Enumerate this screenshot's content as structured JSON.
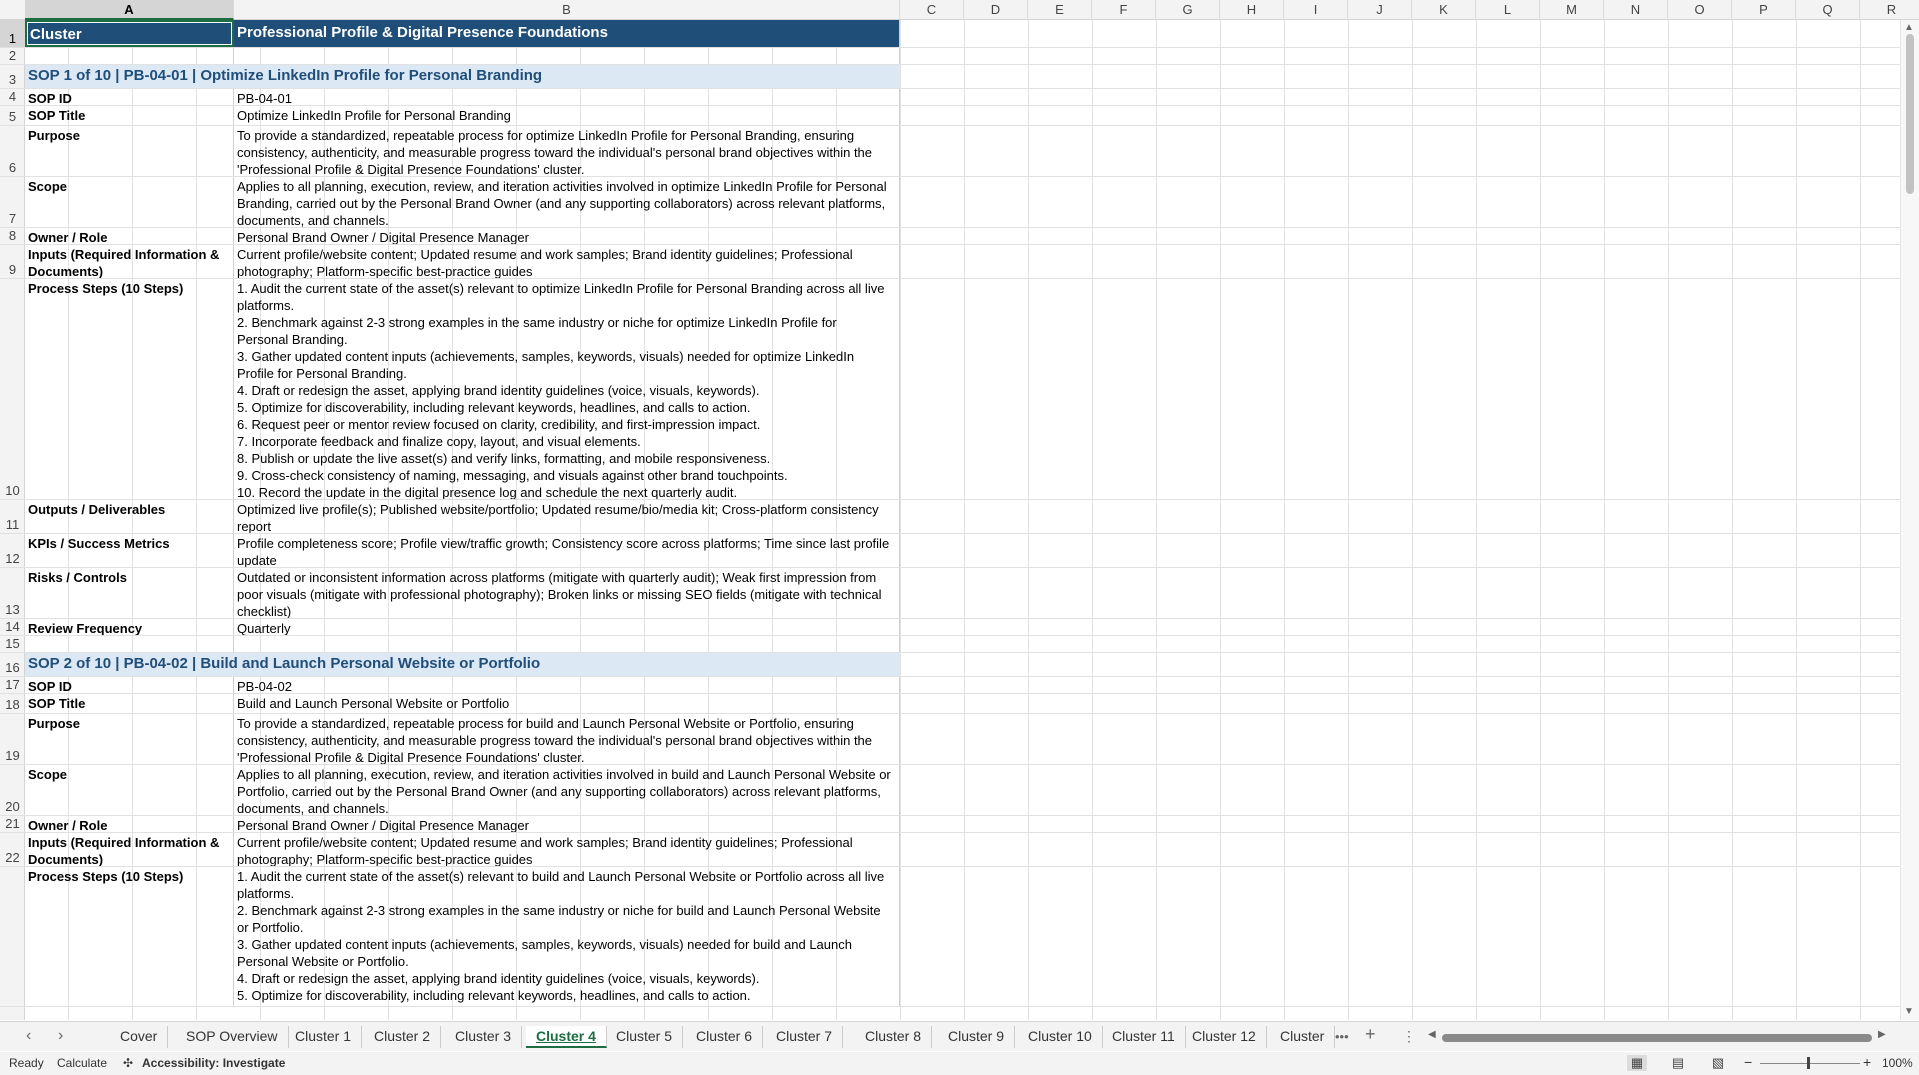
{
  "columns": [
    "A",
    "B",
    "C",
    "D",
    "E",
    "F",
    "G",
    "H",
    "I",
    "J",
    "K",
    "L",
    "M",
    "N",
    "O",
    "P",
    "Q",
    "R"
  ],
  "rows": [
    {
      "num": "1",
      "type": "title",
      "a": "Cluster",
      "b": "Professional Profile & Digital Presence Foundations"
    },
    {
      "num": "2",
      "type": "blank"
    },
    {
      "num": "3",
      "type": "sop",
      "text": "SOP 1 of 10  |  PB-04-01  |  Optimize LinkedIn Profile for Personal Branding"
    },
    {
      "num": "4",
      "type": "field",
      "a": "SOP ID",
      "b": "PB-04-01"
    },
    {
      "num": "5",
      "type": "field",
      "a": "SOP Title",
      "b": "Optimize LinkedIn Profile for Personal Branding"
    },
    {
      "num": "6",
      "type": "field",
      "a": "Purpose",
      "b": "To provide a standardized, repeatable process for optimize LinkedIn Profile for Personal Branding, ensuring\nconsistency, authenticity, and measurable progress toward the individual's personal brand objectives within the\n'Professional Profile & Digital Presence Foundations' cluster."
    },
    {
      "num": "7",
      "type": "field",
      "a": "Scope",
      "b": "Applies to all planning, execution, review, and iteration activities involved in optimize LinkedIn Profile for Personal\nBranding, carried out by the Personal Brand Owner (and any supporting collaborators) across relevant platforms,\ndocuments, and channels."
    },
    {
      "num": "8",
      "type": "field",
      "a": "Owner / Role",
      "b": "Personal Brand Owner / Digital Presence Manager"
    },
    {
      "num": "9",
      "type": "field",
      "a": "Inputs (Required Information &\nDocuments)",
      "b": "Current profile/website content; Updated resume and work samples; Brand identity guidelines; Professional\nphotography; Platform-specific best-practice guides"
    },
    {
      "num": "10",
      "type": "field",
      "a": "Process Steps (10 Steps)",
      "b": "1. Audit the current state of the asset(s) relevant to optimize LinkedIn Profile for Personal Branding across all live\nplatforms.\n2. Benchmark against 2-3 strong examples in the same industry or niche for optimize LinkedIn Profile for\nPersonal Branding.\n3. Gather updated content inputs (achievements, samples, keywords, visuals) needed for optimize LinkedIn\nProfile for Personal Branding.\n4. Draft or redesign the asset, applying brand identity guidelines (voice, visuals, keywords).\n5. Optimize for discoverability, including relevant keywords, headlines, and calls to action.\n6. Request peer or mentor review focused on clarity, credibility, and first-impression impact.\n7. Incorporate feedback and finalize copy, layout, and visual elements.\n8. Publish or update the live asset(s) and verify links, formatting, and mobile responsiveness.\n9. Cross-check consistency of naming, messaging, and visuals against other brand touchpoints.\n10. Record the update in the digital presence log and schedule the next quarterly audit."
    },
    {
      "num": "11",
      "type": "field",
      "a": "Outputs / Deliverables",
      "b": "Optimized live profile(s); Published website/portfolio; Updated resume/bio/media kit; Cross-platform consistency\nreport"
    },
    {
      "num": "12",
      "type": "field",
      "a": "KPIs / Success Metrics",
      "b": "Profile completeness score; Profile view/traffic growth; Consistency score across platforms; Time since last profile\nupdate"
    },
    {
      "num": "13",
      "type": "field",
      "a": "Risks / Controls",
      "b": "Outdated or inconsistent information across platforms (mitigate with quarterly audit); Weak first impression from\npoor visuals (mitigate with professional photography); Broken links or missing SEO fields (mitigate with technical\nchecklist)"
    },
    {
      "num": "14",
      "type": "field",
      "a": "Review Frequency",
      "b": "Quarterly"
    },
    {
      "num": "15",
      "type": "blank"
    },
    {
      "num": "16",
      "type": "sop",
      "text": "SOP 2 of 10  |  PB-04-02  |  Build and Launch Personal Website or Portfolio"
    },
    {
      "num": "17",
      "type": "field",
      "a": "SOP ID",
      "b": "PB-04-02"
    },
    {
      "num": "18",
      "type": "field",
      "a": "SOP Title",
      "b": "Build and Launch Personal Website or Portfolio"
    },
    {
      "num": "19",
      "type": "field",
      "a": "Purpose",
      "b": "To provide a standardized, repeatable process for build and Launch Personal Website or Portfolio, ensuring\nconsistency, authenticity, and measurable progress toward the individual's personal brand objectives within the\n'Professional Profile & Digital Presence Foundations' cluster."
    },
    {
      "num": "20",
      "type": "field",
      "a": "Scope",
      "b": "Applies to all planning, execution, review, and iteration activities involved in build and Launch Personal Website or\nPortfolio, carried out by the Personal Brand Owner (and any supporting collaborators) across relevant platforms,\ndocuments, and channels."
    },
    {
      "num": "21",
      "type": "field",
      "a": "Owner / Role",
      "b": "Personal Brand Owner / Digital Presence Manager"
    },
    {
      "num": "22",
      "type": "field",
      "a": "Inputs (Required Information &\nDocuments)",
      "b": "Current profile/website content; Updated resume and work samples; Brand identity guidelines; Professional\nphotography; Platform-specific best-practice guides"
    },
    {
      "num": "",
      "type": "field",
      "a": "Process Steps (10 Steps)",
      "b": "1. Audit the current state of the asset(s) relevant to build and Launch Personal Website or Portfolio across all live\nplatforms.\n2. Benchmark against 2-3 strong examples in the same industry or niche for build and Launch Personal Website\nor Portfolio.\n3. Gather updated content inputs (achievements, samples, keywords, visuals) needed for build and Launch\nPersonal Website or Portfolio.\n4. Draft or redesign the asset, applying brand identity guidelines (voice, visuals, keywords).\n5. Optimize for discoverability, including relevant keywords, headlines, and calls to action."
    }
  ],
  "tabs": [
    "Cover",
    "SOP Overview",
    "Cluster 1",
    "Cluster 2",
    "Cluster 3",
    "Cluster 4",
    "Cluster 5",
    "Cluster 6",
    "Cluster 7",
    "Cluster 8",
    "Cluster 9",
    "Cluster 10",
    "Cluster 11",
    "Cluster 12",
    "Cluster"
  ],
  "active_tab": "Cluster 4",
  "status": {
    "ready": "Ready",
    "calculate": "Calculate",
    "accessibility": "Accessibility: Investigate",
    "zoom": "100%"
  }
}
